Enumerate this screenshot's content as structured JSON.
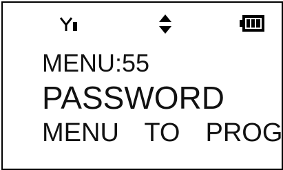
{
  "status_bar": {
    "icons": [
      "signal-antenna-icon",
      "up-down-arrows-icon",
      "battery-icon"
    ]
  },
  "screen": {
    "menu_line": "MENU:55",
    "title_line": "PASSWORD",
    "hint_line": "MENU  TO  PROG"
  },
  "colors": {
    "background": "#ffffff",
    "foreground": "#000000"
  }
}
